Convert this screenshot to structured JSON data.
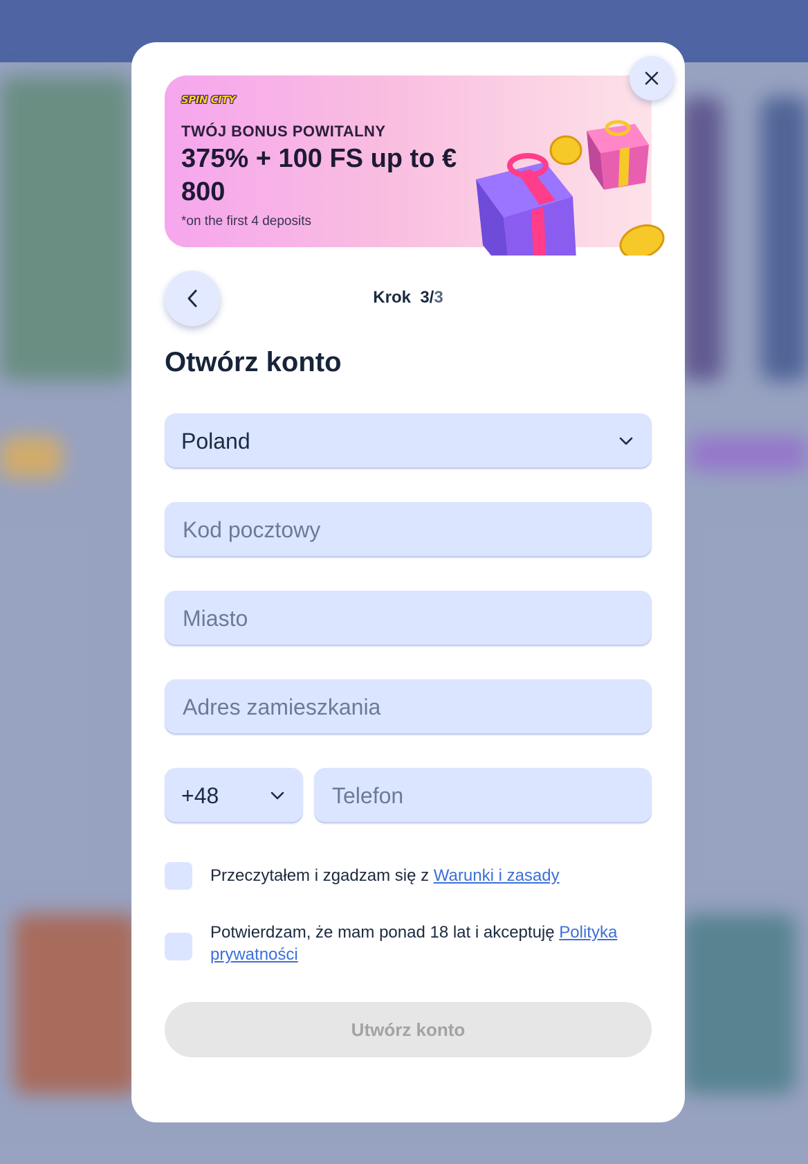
{
  "banner": {
    "brand": "SPIN CITY",
    "subtitle": "TWÓJ BONUS POWITALNY",
    "title": "375% + 100 FS up to € 800",
    "note": "*on the first 4 deposits"
  },
  "step": {
    "label": "Krok",
    "current": "3",
    "separator": "/",
    "total": "3"
  },
  "form": {
    "title": "Otwórz konto",
    "country_value": "Poland",
    "postal_placeholder": "Kod pocztowy",
    "city_placeholder": "Miasto",
    "address_placeholder": "Adres zamieszkania",
    "phone_prefix": "+48",
    "phone_placeholder": "Telefon",
    "terms_text": "Przeczytałem i zgadzam się z ",
    "terms_link": "Warunki i zasady",
    "age_text": "Potwierdzam, że mam ponad 18 lat i akceptuję ",
    "age_link": "Polityka prywatności",
    "submit_label": "Utwórz konto"
  },
  "icons": {
    "close": "close-icon",
    "back": "chevron-left-icon",
    "dropdown": "chevron-down-icon"
  },
  "colors": {
    "field_bg": "#dbe5ff",
    "link": "#3d6fd8",
    "submit_disabled_bg": "#e6e6e6"
  }
}
